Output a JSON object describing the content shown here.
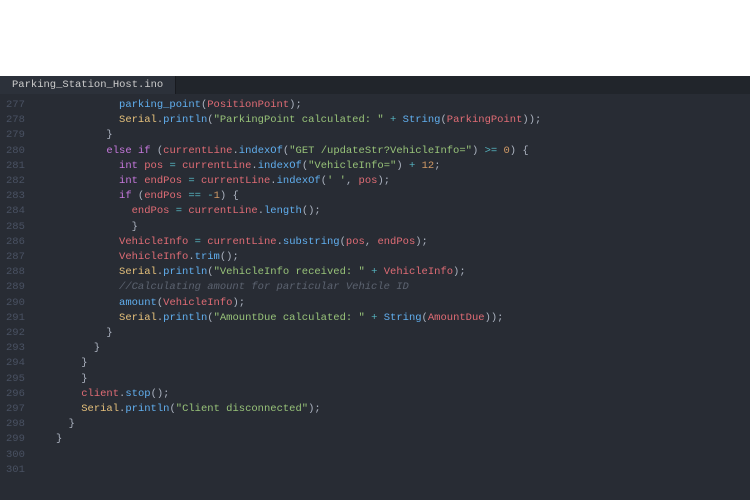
{
  "tab": {
    "title": "Parking_Station_Host.ino"
  },
  "gutter": {
    "start": 277,
    "end": 301
  },
  "code": {
    "lines": [
      {
        "indent": 10,
        "tokens": [
          {
            "c": "fn",
            "t": "parking_point"
          },
          {
            "c": "punct",
            "t": "("
          },
          {
            "c": "id",
            "t": "PositionPoint"
          },
          {
            "c": "punct",
            "t": ");"
          }
        ]
      },
      {
        "indent": 10,
        "tokens": [
          {
            "c": "obj",
            "t": "Serial"
          },
          {
            "c": "punct",
            "t": "."
          },
          {
            "c": "fn",
            "t": "println"
          },
          {
            "c": "punct",
            "t": "("
          },
          {
            "c": "str",
            "t": "\"ParkingPoint calculated: \""
          },
          {
            "c": "punct",
            "t": " "
          },
          {
            "c": "op",
            "t": "+"
          },
          {
            "c": "punct",
            "t": " "
          },
          {
            "c": "fn",
            "t": "String"
          },
          {
            "c": "punct",
            "t": "("
          },
          {
            "c": "id",
            "t": "ParkingPoint"
          },
          {
            "c": "punct",
            "t": "));"
          }
        ]
      },
      {
        "indent": 8,
        "tokens": [
          {
            "c": "punct",
            "t": "}"
          }
        ]
      },
      {
        "indent": 0,
        "tokens": []
      },
      {
        "indent": 8,
        "tokens": [
          {
            "c": "kw",
            "t": "else"
          },
          {
            "c": "punct",
            "t": " "
          },
          {
            "c": "kw",
            "t": "if"
          },
          {
            "c": "punct",
            "t": " ("
          },
          {
            "c": "id",
            "t": "currentLine"
          },
          {
            "c": "punct",
            "t": "."
          },
          {
            "c": "fn",
            "t": "indexOf"
          },
          {
            "c": "punct",
            "t": "("
          },
          {
            "c": "str",
            "t": "\"GET /updateStr?VehicleInfo=\""
          },
          {
            "c": "punct",
            "t": ") "
          },
          {
            "c": "op",
            "t": ">="
          },
          {
            "c": "punct",
            "t": " "
          },
          {
            "c": "num",
            "t": "0"
          },
          {
            "c": "punct",
            "t": ") {"
          }
        ]
      },
      {
        "indent": 10,
        "tokens": [
          {
            "c": "type",
            "t": "int"
          },
          {
            "c": "punct",
            "t": " "
          },
          {
            "c": "id",
            "t": "pos"
          },
          {
            "c": "punct",
            "t": " "
          },
          {
            "c": "op",
            "t": "="
          },
          {
            "c": "punct",
            "t": " "
          },
          {
            "c": "id",
            "t": "currentLine"
          },
          {
            "c": "punct",
            "t": "."
          },
          {
            "c": "fn",
            "t": "indexOf"
          },
          {
            "c": "punct",
            "t": "("
          },
          {
            "c": "str",
            "t": "\"VehicleInfo=\""
          },
          {
            "c": "punct",
            "t": ") "
          },
          {
            "c": "op",
            "t": "+"
          },
          {
            "c": "punct",
            "t": " "
          },
          {
            "c": "num",
            "t": "12"
          },
          {
            "c": "punct",
            "t": ";"
          }
        ]
      },
      {
        "indent": 10,
        "tokens": [
          {
            "c": "type",
            "t": "int"
          },
          {
            "c": "punct",
            "t": " "
          },
          {
            "c": "id",
            "t": "endPos"
          },
          {
            "c": "punct",
            "t": " "
          },
          {
            "c": "op",
            "t": "="
          },
          {
            "c": "punct",
            "t": " "
          },
          {
            "c": "id",
            "t": "currentLine"
          },
          {
            "c": "punct",
            "t": "."
          },
          {
            "c": "fn",
            "t": "indexOf"
          },
          {
            "c": "punct",
            "t": "("
          },
          {
            "c": "char",
            "t": "' '"
          },
          {
            "c": "punct",
            "t": ", "
          },
          {
            "c": "id",
            "t": "pos"
          },
          {
            "c": "punct",
            "t": ");"
          }
        ]
      },
      {
        "indent": 10,
        "tokens": [
          {
            "c": "kw",
            "t": "if"
          },
          {
            "c": "punct",
            "t": " ("
          },
          {
            "c": "id",
            "t": "endPos"
          },
          {
            "c": "punct",
            "t": " "
          },
          {
            "c": "op",
            "t": "=="
          },
          {
            "c": "punct",
            "t": " "
          },
          {
            "c": "op",
            "t": "-"
          },
          {
            "c": "num",
            "t": "1"
          },
          {
            "c": "punct",
            "t": ") {"
          }
        ]
      },
      {
        "indent": 12,
        "tokens": [
          {
            "c": "id",
            "t": "endPos"
          },
          {
            "c": "punct",
            "t": " "
          },
          {
            "c": "op",
            "t": "="
          },
          {
            "c": "punct",
            "t": " "
          },
          {
            "c": "id",
            "t": "currentLine"
          },
          {
            "c": "punct",
            "t": "."
          },
          {
            "c": "fn",
            "t": "length"
          },
          {
            "c": "punct",
            "t": "();"
          }
        ]
      },
      {
        "indent": 12,
        "tokens": [
          {
            "c": "punct",
            "t": "}"
          }
        ]
      },
      {
        "indent": 10,
        "tokens": [
          {
            "c": "id",
            "t": "VehicleInfo"
          },
          {
            "c": "punct",
            "t": " "
          },
          {
            "c": "op",
            "t": "="
          },
          {
            "c": "punct",
            "t": " "
          },
          {
            "c": "id",
            "t": "currentLine"
          },
          {
            "c": "punct",
            "t": "."
          },
          {
            "c": "fn",
            "t": "substring"
          },
          {
            "c": "punct",
            "t": "("
          },
          {
            "c": "id",
            "t": "pos"
          },
          {
            "c": "punct",
            "t": ", "
          },
          {
            "c": "id",
            "t": "endPos"
          },
          {
            "c": "punct",
            "t": ");"
          }
        ]
      },
      {
        "indent": 10,
        "tokens": [
          {
            "c": "id",
            "t": "VehicleInfo"
          },
          {
            "c": "punct",
            "t": "."
          },
          {
            "c": "fn",
            "t": "trim"
          },
          {
            "c": "punct",
            "t": "();"
          }
        ]
      },
      {
        "indent": 10,
        "tokens": [
          {
            "c": "obj",
            "t": "Serial"
          },
          {
            "c": "punct",
            "t": "."
          },
          {
            "c": "fn",
            "t": "println"
          },
          {
            "c": "punct",
            "t": "("
          },
          {
            "c": "str",
            "t": "\"VehicleInfo received: \""
          },
          {
            "c": "punct",
            "t": " "
          },
          {
            "c": "op",
            "t": "+"
          },
          {
            "c": "punct",
            "t": " "
          },
          {
            "c": "id",
            "t": "VehicleInfo"
          },
          {
            "c": "punct",
            "t": ");"
          }
        ]
      },
      {
        "indent": 10,
        "tokens": [
          {
            "c": "com",
            "t": "//Calculating amount for particular Vehicle ID"
          }
        ]
      },
      {
        "indent": 10,
        "tokens": [
          {
            "c": "fn",
            "t": "amount"
          },
          {
            "c": "punct",
            "t": "("
          },
          {
            "c": "id",
            "t": "VehicleInfo"
          },
          {
            "c": "punct",
            "t": ");"
          }
        ]
      },
      {
        "indent": 10,
        "tokens": [
          {
            "c": "obj",
            "t": "Serial"
          },
          {
            "c": "punct",
            "t": "."
          },
          {
            "c": "fn",
            "t": "println"
          },
          {
            "c": "punct",
            "t": "("
          },
          {
            "c": "str",
            "t": "\"AmountDue calculated: \""
          },
          {
            "c": "punct",
            "t": " "
          },
          {
            "c": "op",
            "t": "+"
          },
          {
            "c": "punct",
            "t": " "
          },
          {
            "c": "fn",
            "t": "String"
          },
          {
            "c": "punct",
            "t": "("
          },
          {
            "c": "id",
            "t": "AmountDue"
          },
          {
            "c": "punct",
            "t": "));"
          }
        ]
      },
      {
        "indent": 8,
        "tokens": [
          {
            "c": "punct",
            "t": "}"
          }
        ]
      },
      {
        "indent": 6,
        "tokens": [
          {
            "c": "punct",
            "t": "}"
          }
        ]
      },
      {
        "indent": 4,
        "tokens": [
          {
            "c": "punct",
            "t": "}"
          }
        ]
      },
      {
        "indent": 4,
        "tokens": [
          {
            "c": "punct",
            "t": "}"
          }
        ]
      },
      {
        "indent": 4,
        "tokens": [
          {
            "c": "id",
            "t": "client"
          },
          {
            "c": "punct",
            "t": "."
          },
          {
            "c": "fn",
            "t": "stop"
          },
          {
            "c": "punct",
            "t": "();"
          }
        ]
      },
      {
        "indent": 4,
        "tokens": [
          {
            "c": "obj",
            "t": "Serial"
          },
          {
            "c": "punct",
            "t": "."
          },
          {
            "c": "fn",
            "t": "println"
          },
          {
            "c": "punct",
            "t": "("
          },
          {
            "c": "str",
            "t": "\"Client disconnected\""
          },
          {
            "c": "punct",
            "t": ");"
          }
        ]
      },
      {
        "indent": 2,
        "tokens": [
          {
            "c": "punct",
            "t": "}"
          }
        ]
      },
      {
        "indent": 0,
        "tokens": [
          {
            "c": "punct",
            "t": "}"
          }
        ]
      },
      {
        "indent": 0,
        "tokens": []
      }
    ]
  }
}
